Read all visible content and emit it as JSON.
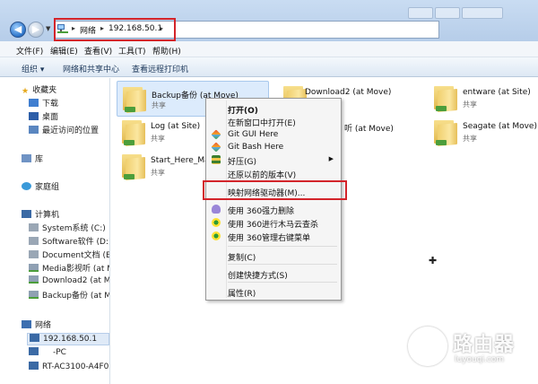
{
  "address": {
    "segments": [
      "网络",
      "192.168.50.1"
    ],
    "highlight_color": "#d3242a"
  },
  "menubar": [
    "文件(F)",
    "编辑(E)",
    "查看(V)",
    "工具(T)",
    "帮助(H)"
  ],
  "commandbar": [
    "组织 ▾",
    "网络和共享中心",
    "查看远程打印机"
  ],
  "navpane": {
    "favorites": {
      "label": "收藏夹",
      "items": [
        "下载",
        "桌面",
        "最近访问的位置"
      ]
    },
    "libraries": "库",
    "homegroup": "家庭组",
    "computer": {
      "label": "计算机",
      "items": [
        "System系统 (C:)",
        "Software软件 (D:)",
        "Document文档 (E:)",
        "Media影视听 (at M",
        "Download2 (at Mc",
        "Backup备份 (at Mc"
      ]
    },
    "network": {
      "label": "网络",
      "items": [
        "192.168.50.1",
        "-PC",
        "RT-AC3100-A4F0"
      ]
    }
  },
  "items": [
    {
      "name": "Backup备份 (at Move)",
      "sub": "共享"
    },
    {
      "name": "Download2 (at Move)",
      "sub": ""
    },
    {
      "name": "entware (at Site)",
      "sub": "共享"
    },
    {
      "name": "Log (at Site)",
      "sub": "共享"
    },
    {
      "name": "听 (at Move)",
      "sub": ""
    },
    {
      "name": "Seagate (at Move)",
      "sub": "共享"
    },
    {
      "name": "Start_Here_Mac",
      "sub": "共享"
    }
  ],
  "context_menu": {
    "open": "打开(O)",
    "open_new": "在新窗口中打开(E)",
    "git_gui": "Git GUI Here",
    "git_bash": "Git Bash Here",
    "haozip": "好压(G)",
    "restore": "还原以前的版本(V)",
    "map_drive": "映射网络驱动器(M)...",
    "del360": "使用 360强力删除",
    "scan360": "使用 360进行木马云查杀",
    "manage360": "使用 360管理右键菜单",
    "copy": "复制(C)",
    "shortcut": "创建快捷方式(S)",
    "properties": "属性(R)"
  },
  "watermark": {
    "cn": "路由器",
    "en": "luyouqi.com"
  }
}
